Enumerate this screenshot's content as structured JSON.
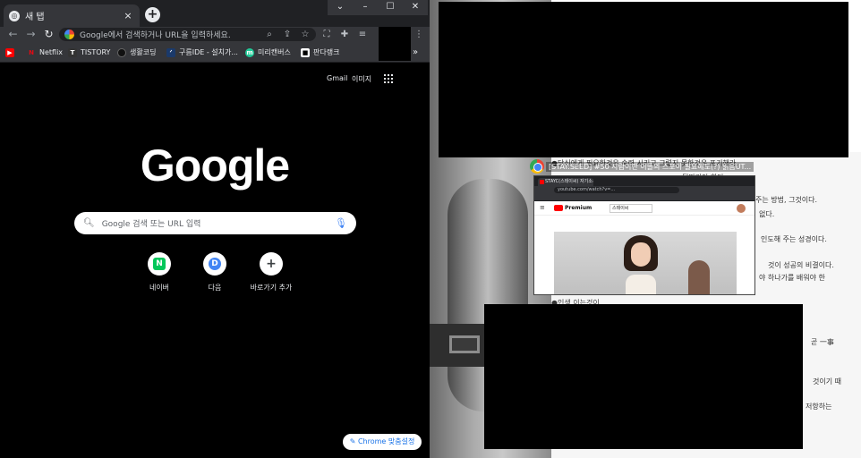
{
  "browser": {
    "tab_title": "새 탭",
    "tab_close": "×",
    "new_tab": "+",
    "omnibox_placeholder": "Google에서 검색하거나 URL을 입력하세요.",
    "bookmarks": [
      {
        "label": "",
        "icon": "youtube-icon",
        "color": "#ff0000"
      },
      {
        "label": "Netflix",
        "icon": "netflix-icon",
        "color": "#e50914"
      },
      {
        "label": "TISTORY",
        "icon": "tistory-icon",
        "color": "#333333"
      },
      {
        "label": "생활코딩",
        "icon": "saenghwal-icon",
        "color": "#111111"
      },
      {
        "label": "구름IDE - 설치가...",
        "icon": "goorm-icon",
        "color": "#1b3a6b"
      },
      {
        "label": "미리캔버스",
        "icon": "miricanvas-icon",
        "color": "#20c997"
      },
      {
        "label": "판다랭크",
        "icon": "pandarank-icon",
        "color": "#111111"
      }
    ],
    "bookmarks_more": "»"
  },
  "ntp": {
    "gmail": "Gmail",
    "images": "이미지",
    "logo": "Google",
    "search_placeholder": "Google 검색 또는 URL 입력",
    "shortcuts": [
      {
        "label": "네이버",
        "glyph": "N",
        "color": "#03c75a"
      },
      {
        "label": "다음",
        "glyph": "D",
        "color": "#4285f4"
      },
      {
        "label": "바로가기 추가",
        "glyph": "+",
        "color": "#3c4043"
      }
    ],
    "customize": "Chrome 맞춤설정"
  },
  "background_article": {
    "headline": "[STAY:SEED] #50 사람이란 이들의 스포이 필요해도(?) 읽음UT...",
    "lines": [
      "●당신에게 필요한것은 숙련 시키고 그렇지 못한것은 포기해라.",
      "뒤따라야 한다.",
      "주는 방법, 그것이다.",
      "없다.",
      "인도해 주는 성경이다.",
      "것이 성공의 비결이다.",
      "야 하나가를 배워야 한",
      "●인생 이는것이 ...",
      "곧 一事",
      "것이기 때",
      "저항하는"
    ]
  },
  "mini_window": {
    "tab": "STAYC(스테이씨) 자기소개 ...",
    "url": "youtube.com/watch?v=...",
    "brand": "Premium",
    "search_text": "스테이씨"
  }
}
